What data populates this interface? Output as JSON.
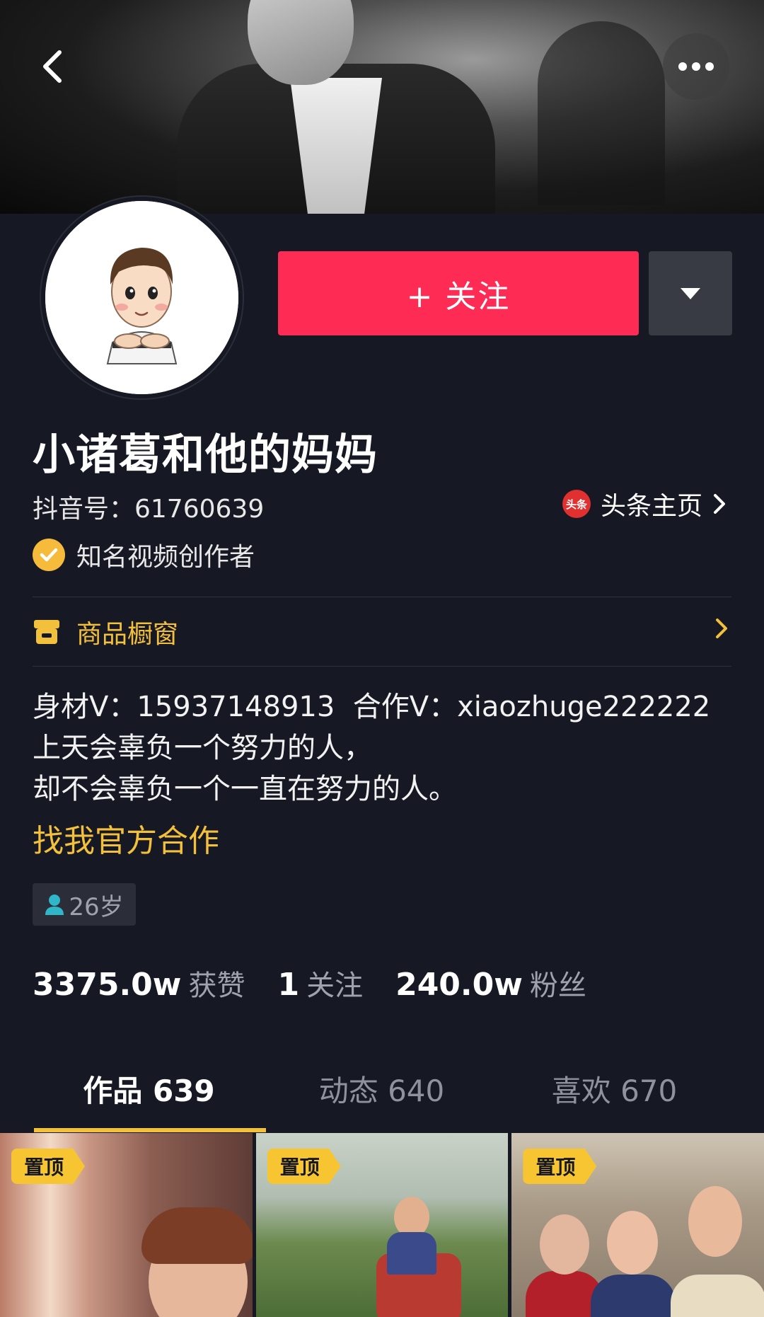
{
  "header": {
    "back_icon": "chevron-left-icon",
    "more_icon": "more-horizontal-icon"
  },
  "profile": {
    "name": "小诸葛和他的妈妈",
    "douyin_id": "抖音号：61760639",
    "toutiao_badge": "头条",
    "toutiao_label": "头条主页",
    "verified_label": "知名视频创作者",
    "follow_label": "+ 关注"
  },
  "shop": {
    "label": "商品橱窗"
  },
  "bio": {
    "lines": "身材V：15937148913  合作V：xiaozhuge222222\n上天会辜负一个努力的人，\n却不会辜负一个一直在努力的人。",
    "link": "找我官方合作"
  },
  "age": "26岁",
  "stats": {
    "likes_num": "3375.0w",
    "likes_label": "获赞",
    "following_num": "1",
    "following_label": "关注",
    "fans_num": "240.0w",
    "fans_label": "粉丝"
  },
  "tabs": [
    {
      "label": "作品 639",
      "active": true
    },
    {
      "label": "动态 640",
      "active": false
    },
    {
      "label": "喜欢 670",
      "active": false
    }
  ],
  "videos": [
    {
      "pin_label": "置顶"
    },
    {
      "pin_label": "置顶"
    },
    {
      "pin_label": "置顶"
    }
  ],
  "colors": {
    "background": "#161823",
    "follow": "#fe2c55",
    "accent_yellow": "#f3c03c"
  }
}
